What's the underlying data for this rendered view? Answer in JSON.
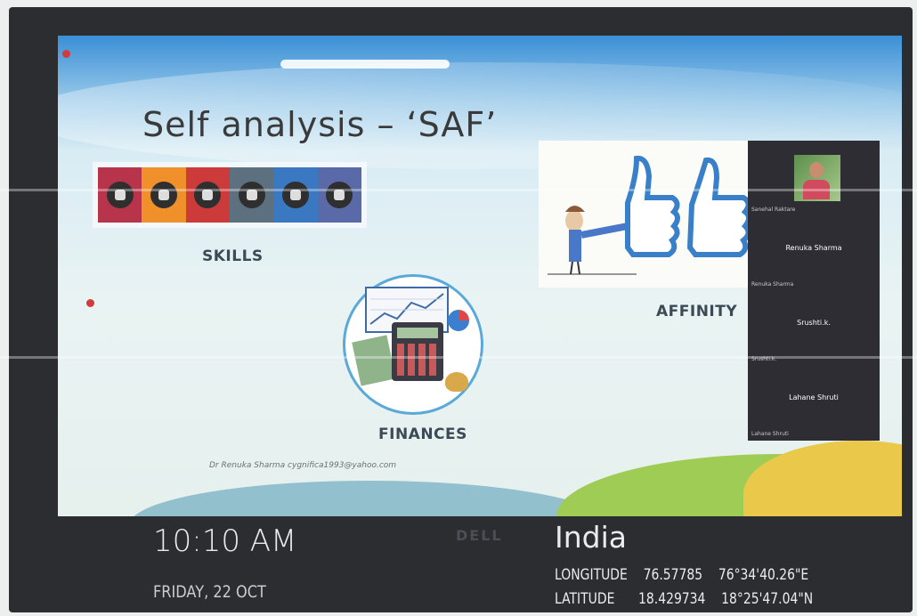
{
  "slide": {
    "title": "Self analysis – ‘SAF’",
    "skills_label": "SKILLS",
    "finances_label": "FINANCES",
    "affinity_label": "AFFINITY",
    "credit": "Dr Renuka Sharma   cygnifica1993@yahoo.com",
    "skills_tile_colors": [
      "#b8344a",
      "#f0902a",
      "#cc3a3a",
      "#5c7080",
      "#3a78c2",
      "#5a6aa8"
    ]
  },
  "participants": [
    {
      "name": "",
      "footer": "Sanehal Raktare"
    },
    {
      "name": "Renuka Sharma",
      "footer": "Renuka Sharma"
    },
    {
      "name": "Srushti.k.",
      "footer": "Srushti.k."
    },
    {
      "name": "Lahane Shruti",
      "footer": "Lahane Shruti"
    }
  ],
  "overlay": {
    "time": "10:10 AM",
    "date": "FRIDAY, 22 OCT",
    "brand": "DELL",
    "country": "India",
    "longitude_label": "LONGITUDE",
    "longitude_decimal": "76.57785",
    "longitude_dms": "76°34'40.26\"E",
    "latitude_label": "LATITUDE",
    "latitude_decimal": "18.429734",
    "latitude_dms": "18°25'47.04\"N"
  },
  "colors": {
    "accent": "#3a8fd6",
    "monitor": "#2b2d31",
    "record_dot": "#d23b3b"
  }
}
